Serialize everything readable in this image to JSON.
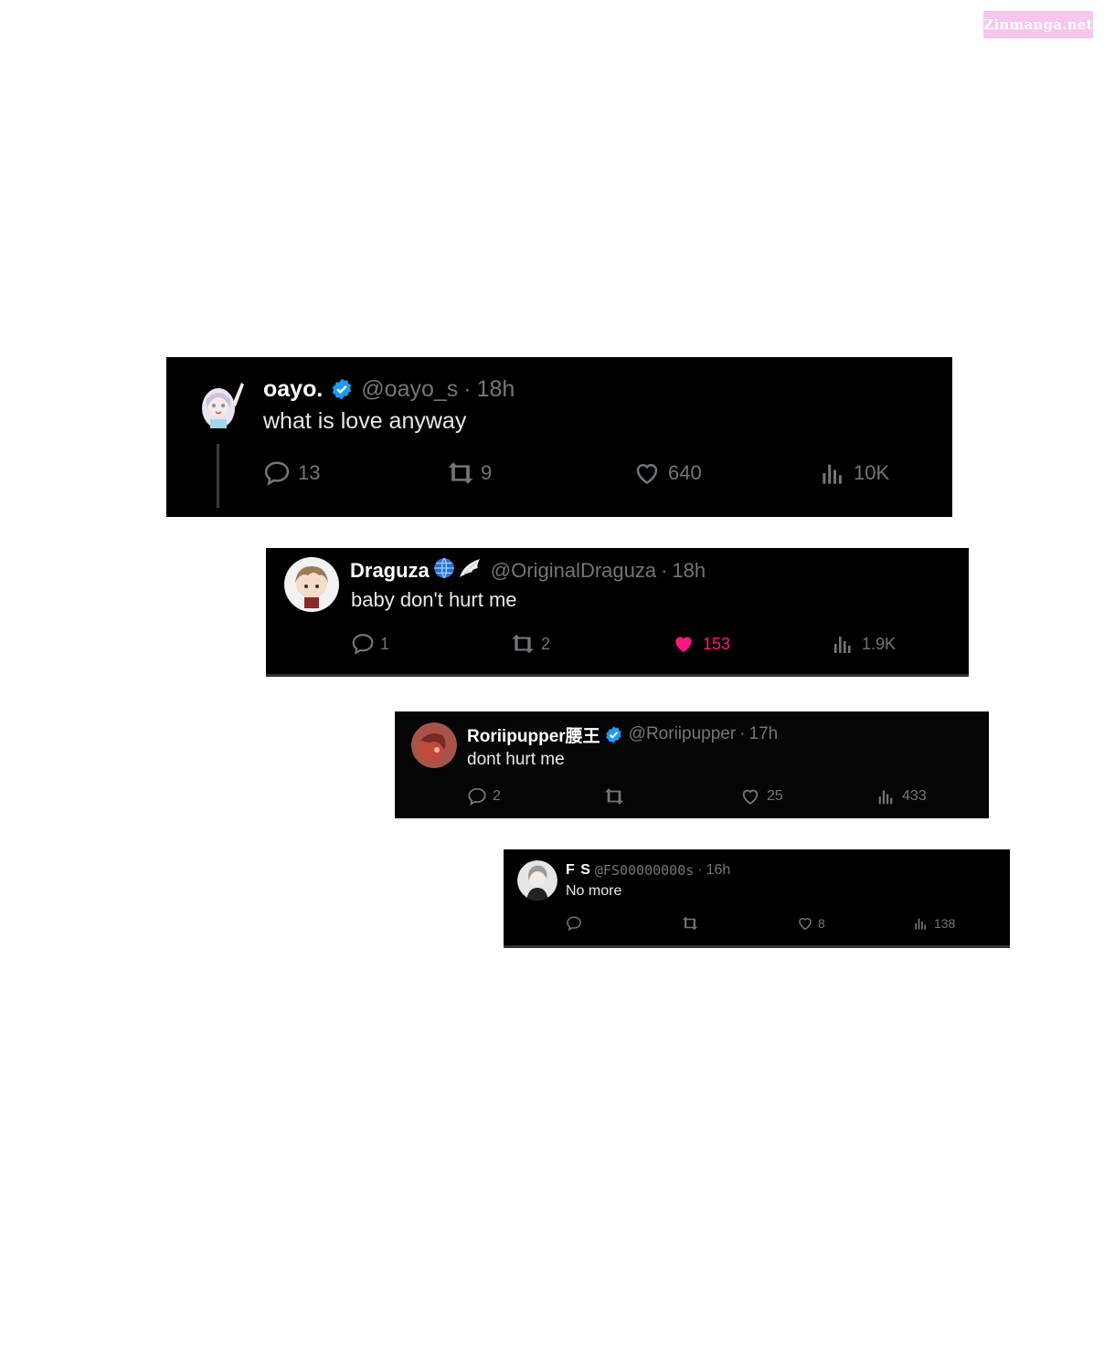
{
  "watermark": "Zinmanga.net",
  "tweets": [
    {
      "name": "oayo.",
      "handle": "@oayo_s",
      "dot": "·",
      "time": "18h",
      "text": "what is love anyway",
      "replies": "13",
      "retweets": "9",
      "likes": "640",
      "views": "10K",
      "verified": true
    },
    {
      "name": "Draguza",
      "handle": "@OriginalDraguza",
      "dot": "·",
      "time": "18h",
      "text": "baby don't hurt me",
      "replies": "1",
      "retweets": "2",
      "likes": "153",
      "views": "1.9K",
      "liked": true
    },
    {
      "name": "Roriipupper腰王",
      "handle": "@Roriipupper",
      "dot": "·",
      "time": "17h",
      "text": "dont hurt me",
      "replies": "2",
      "retweets": "",
      "likes": "25",
      "views": "433",
      "verified": true
    },
    {
      "name": "F S",
      "handle": "@FS00000000s",
      "dot": "·",
      "time": "16h",
      "text": "No more",
      "replies": "",
      "retweets": "",
      "likes": "8",
      "views": "138"
    }
  ],
  "colors": {
    "background": "#000000",
    "text": "#e7e9ea",
    "muted": "#71767b",
    "like": "#f91880",
    "verified": "#1d9bf0"
  }
}
